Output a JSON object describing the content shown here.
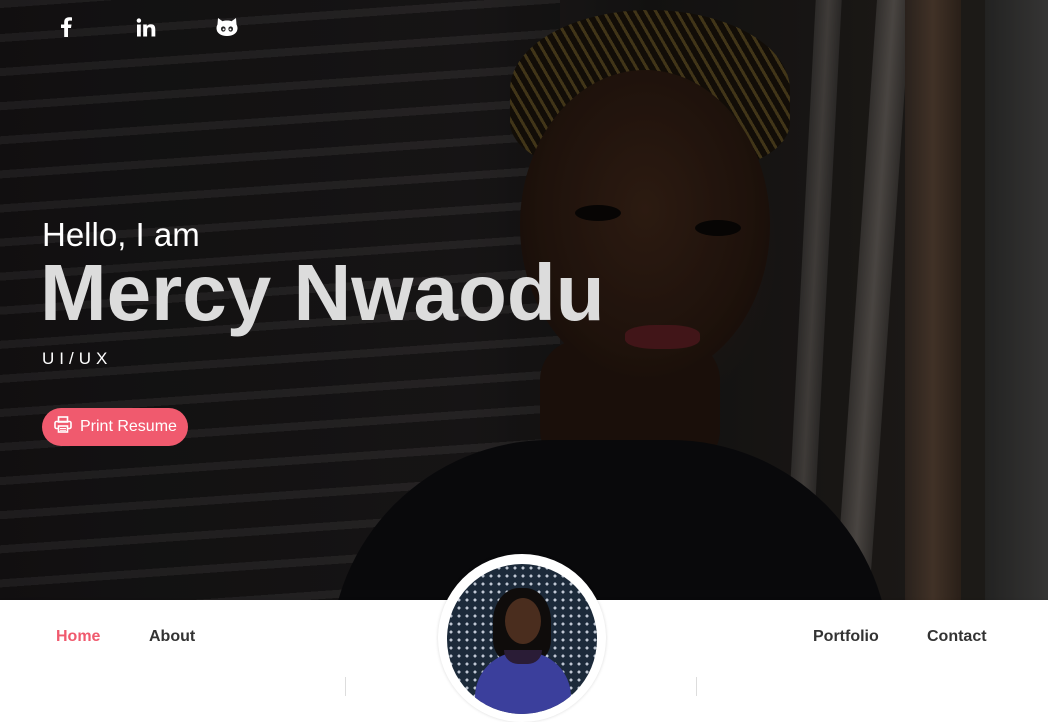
{
  "social": {
    "facebook": "facebook-icon",
    "linkedin": "linkedin-icon",
    "github": "github-icon"
  },
  "hero": {
    "greeting": "Hello, I am",
    "name": "Mercy Nwaodu",
    "role": "UI/UX",
    "print_button": "Print Resume",
    "print_icon": "printer-icon"
  },
  "nav": {
    "items": [
      {
        "label": "Home",
        "active": true
      },
      {
        "label": "About",
        "active": false
      },
      {
        "label": "Portfolio",
        "active": false
      },
      {
        "label": "Contact",
        "active": false
      }
    ]
  },
  "colors": {
    "accent": "#f05a6e",
    "nav_text": "#333333",
    "hero_text": "#ffffff",
    "name_text": "#dcdcdc"
  }
}
